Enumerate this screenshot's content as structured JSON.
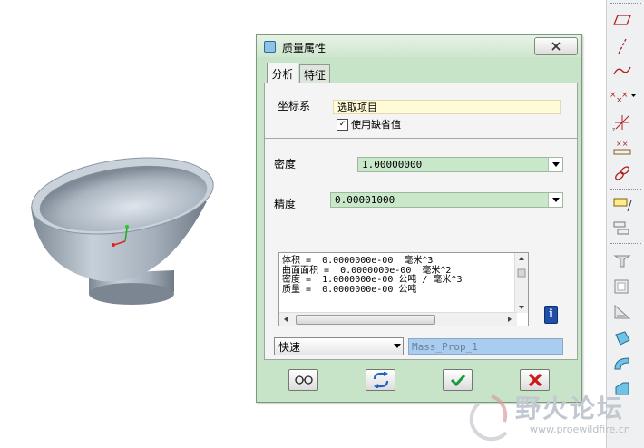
{
  "dialog": {
    "title": "质量属性",
    "tabs": [
      {
        "label": "分析",
        "active": true
      },
      {
        "label": "特征",
        "active": false
      }
    ],
    "coordinate_system": {
      "label": "坐标系",
      "value": "选取项目",
      "use_default": {
        "label": "使用缺省值",
        "checked": true
      }
    },
    "density": {
      "label": "密度",
      "value": "1.00000000"
    },
    "precision": {
      "label": "精度",
      "value": "0.00001000"
    },
    "results": [
      "体积 =  0.0000000e-00  毫米^3",
      "曲面面积 =  0.0000000e-00  毫米^2",
      "密度 =  1.0000000e-00 公吨 / 毫米^3",
      "质量 =  0.0000000e-00 公吨"
    ],
    "mode": {
      "value": "快速"
    },
    "feature_name": "Mass_Prop_1",
    "actions": [
      {
        "name": "preview-button",
        "icon": "glasses-icon"
      },
      {
        "name": "repeat-button",
        "icon": "refresh-arrows-icon"
      },
      {
        "name": "ok-button",
        "icon": "checkmark-icon"
      },
      {
        "name": "cancel-button",
        "icon": "red-x-icon"
      }
    ]
  },
  "watermark": {
    "text": "野火论坛",
    "url": "www.proewildfire.cn"
  },
  "colors": {
    "dialog_bg": "#c8e4c8",
    "field_green": "#c9e8c9",
    "field_yellow": "#fffbd6",
    "field_blue": "#a9cdf0",
    "bowl": "#9aa6b2"
  }
}
